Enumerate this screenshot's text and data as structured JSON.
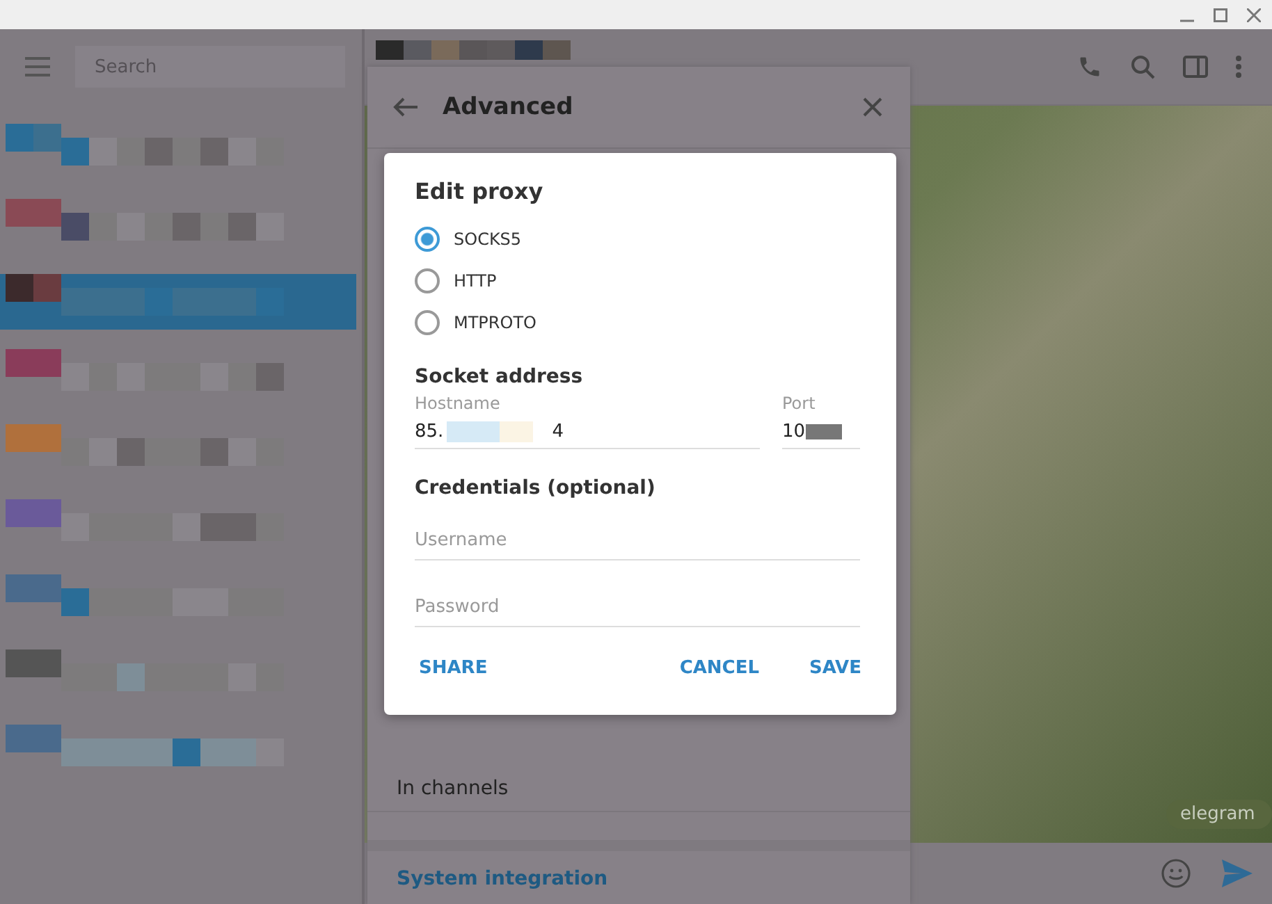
{
  "sidebar": {
    "search": {
      "placeholder": "Search"
    }
  },
  "advanced_panel": {
    "title": "Advanced",
    "items": [
      {
        "label": "In channels",
        "kind": "plain"
      },
      {
        "label": "System integration",
        "kind": "section"
      }
    ]
  },
  "chat": {
    "bubble": "elegram"
  },
  "dialog": {
    "title": "Edit proxy",
    "options": [
      {
        "label": "SOCKS5",
        "selected": true
      },
      {
        "label": "HTTP",
        "selected": false
      },
      {
        "label": "MTPROTO",
        "selected": false
      }
    ],
    "socket_heading": "Socket address",
    "hostname": {
      "label": "Hostname",
      "value_start": "85.",
      "value_end": "4"
    },
    "port": {
      "label": "Port",
      "value_start": "10"
    },
    "credentials_heading": "Credentials (optional)",
    "username": {
      "placeholder": "Username"
    },
    "password": {
      "placeholder": "Password"
    },
    "buttons": [
      {
        "label": "SHARE",
        "kind": "left"
      },
      {
        "label": "CANCEL",
        "kind": "right"
      },
      {
        "label": "SAVE",
        "kind": "right"
      }
    ]
  }
}
